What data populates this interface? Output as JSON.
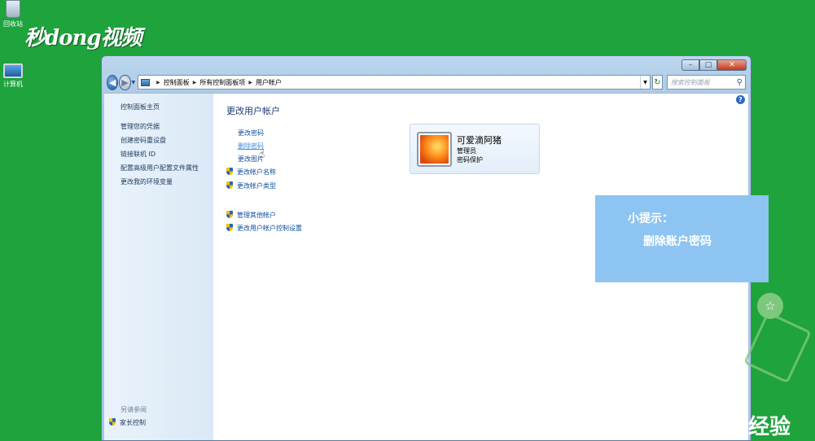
{
  "desktop": {
    "recycle_bin_label": "回收站",
    "computer_label": "计算机",
    "logo_text": "秒dong视频",
    "watermark_text": "经验"
  },
  "window": {
    "caption": {
      "minimize": "–",
      "maximize": "□",
      "close": "✕"
    },
    "breadcrumbs": [
      "控制面板",
      "所有控制面板项",
      "用户帐户"
    ],
    "search_placeholder": "搜索控制面板",
    "help_label": "?"
  },
  "sidebar": {
    "home": "控制面板主页",
    "links": [
      "管理您的凭据",
      "创建密码重设盘",
      "链接联机 ID",
      "配置高级用户配置文件属性",
      "更改我的环境变量"
    ],
    "see_also_heading": "另请参阅",
    "see_also_link": "家长控制"
  },
  "main": {
    "title": "更改用户帐户",
    "tasks": [
      "更改密码",
      "删除密码",
      "更改图片"
    ],
    "shield_tasks": [
      "更改帐户名称",
      "更改帐户类型"
    ],
    "other_tasks": [
      "管理其他帐户",
      "更改用户帐户控制设置"
    ],
    "hovered_task": "删除密码"
  },
  "account": {
    "name": "可爱滴阿猪",
    "role": "管理员",
    "status": "密码保护"
  },
  "tip": {
    "title": "小提示：",
    "body": "删除账户密码"
  },
  "colors": {
    "desktop_bg": "#1fa33c",
    "tip_bg": "#8dc4f2",
    "link": "#0b4d9e"
  }
}
